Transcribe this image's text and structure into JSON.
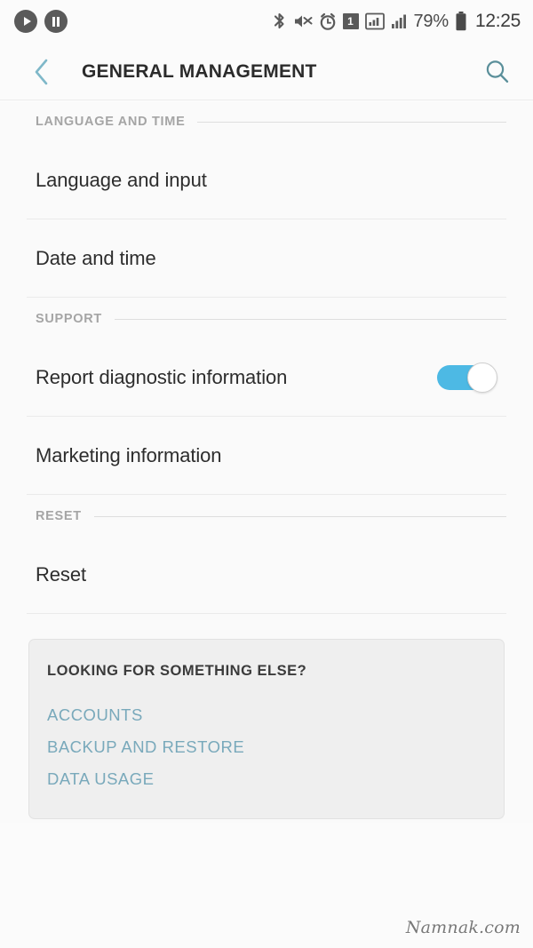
{
  "status_bar": {
    "left_icons": [
      {
        "name": "media-play-icon",
        "glyph": "play"
      },
      {
        "name": "media-pause-icon",
        "glyph": "pause"
      }
    ],
    "right_icons": [
      {
        "name": "bluetooth-icon"
      },
      {
        "name": "sound-mute-icon"
      },
      {
        "name": "alarm-clock-icon"
      },
      {
        "name": "sim-1-icon",
        "label": "1"
      },
      {
        "name": "signal-sim1-icon"
      },
      {
        "name": "signal-sim2-icon"
      }
    ],
    "battery_percent": "79%",
    "time": "12:25"
  },
  "app_bar": {
    "back_label": "Back",
    "title": "GENERAL MANAGEMENT",
    "search_label": "Search"
  },
  "sections": [
    {
      "header": "LANGUAGE AND TIME",
      "items": [
        {
          "title": "Language and input",
          "type": "link"
        },
        {
          "title": "Date and time",
          "type": "link"
        }
      ]
    },
    {
      "header": "SUPPORT",
      "items": [
        {
          "title": "Report diagnostic information",
          "type": "switch",
          "checked": true
        },
        {
          "title": "Marketing information",
          "type": "link"
        }
      ]
    },
    {
      "header": "RESET",
      "items": [
        {
          "title": "Reset",
          "type": "link"
        }
      ]
    }
  ],
  "else_card": {
    "title": "LOOKING FOR SOMETHING ELSE?",
    "links": [
      "ACCOUNTS",
      "BACKUP AND RESTORE",
      "DATA USAGE"
    ]
  },
  "watermark": "Namnak.com",
  "colors": {
    "accent_teal": "#79a9bb",
    "toggle_on": "#4db9e4",
    "page_background": "#fafafa",
    "card_background": "#efefef",
    "primary_text": "#2d2d2d",
    "secondary_text": "#a5a5a5"
  }
}
